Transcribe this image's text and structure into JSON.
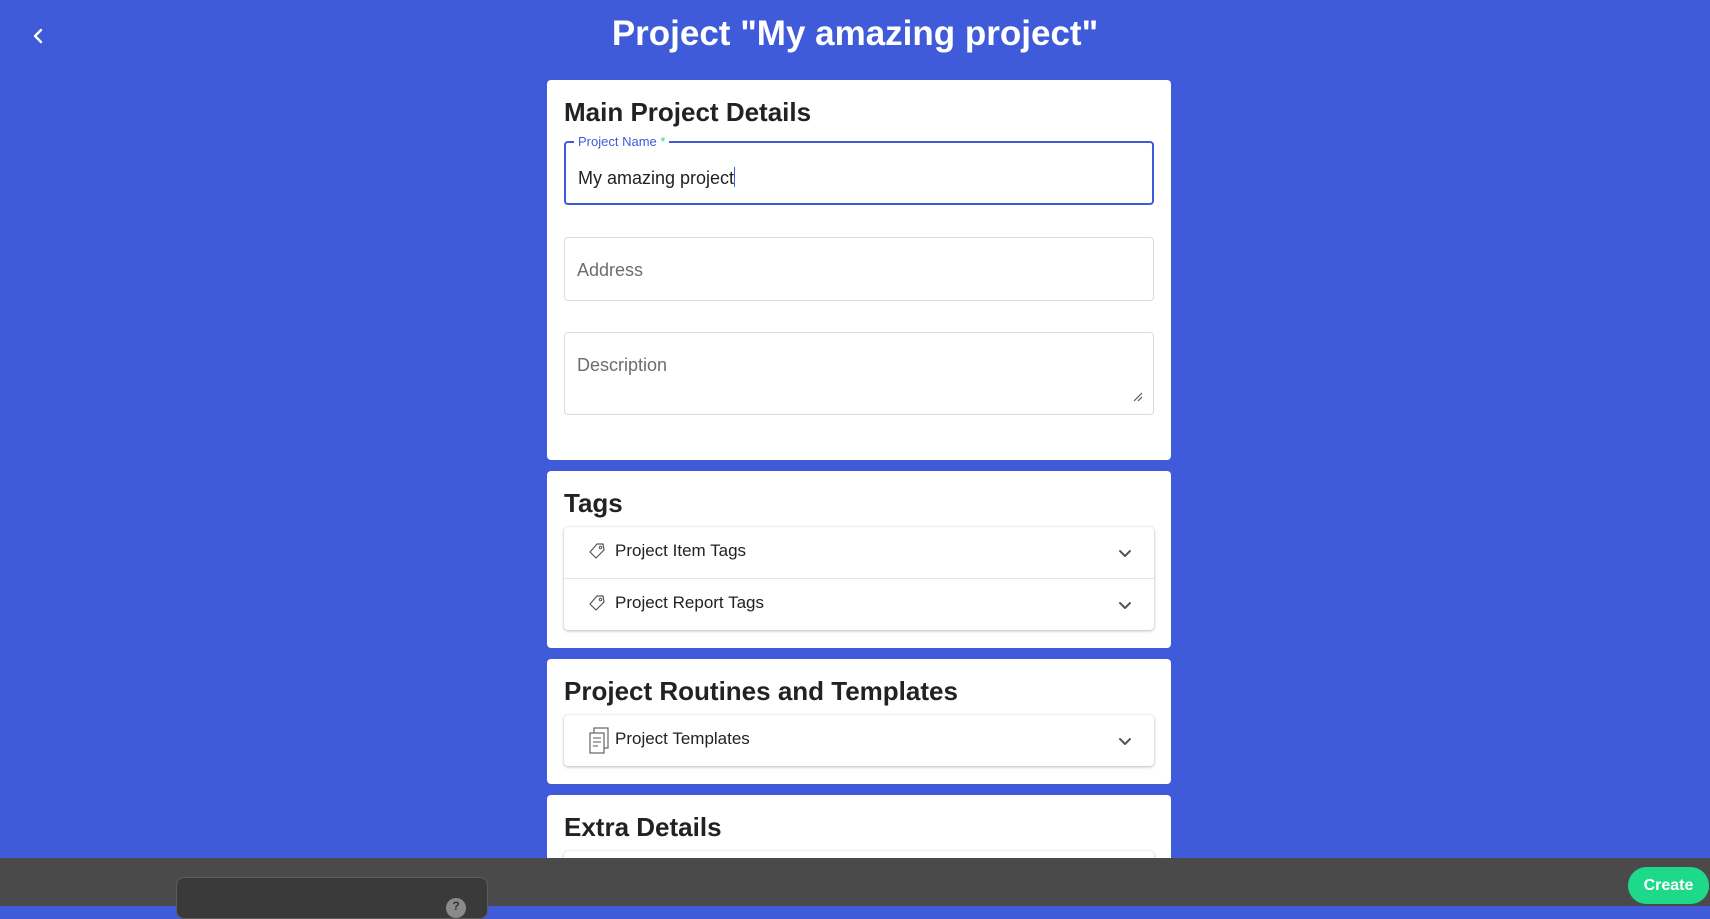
{
  "header": {
    "title": "Project \"My amazing project\""
  },
  "main_details": {
    "heading": "Main Project Details",
    "project_name": {
      "label": "Project Name",
      "required_mark": "*",
      "value": "My amazing project"
    },
    "address": {
      "placeholder": "Address"
    },
    "description": {
      "placeholder": "Description"
    }
  },
  "tags": {
    "heading": "Tags",
    "items": [
      {
        "label": "Project Item Tags",
        "icon": "tag-icon"
      },
      {
        "label": "Project Report Tags",
        "icon": "tag-icon"
      }
    ]
  },
  "routines": {
    "heading": "Project Routines and Templates",
    "items": [
      {
        "label": "Project Templates",
        "icon": "templates-icon"
      }
    ]
  },
  "extra": {
    "heading": "Extra Details"
  },
  "footer": {
    "create_label": "Create"
  },
  "colors": {
    "background": "#3f5bd9",
    "accent": "#3f5bd9",
    "create_button": "#1fd98a",
    "bottom_bar": "#4a4a4a"
  }
}
